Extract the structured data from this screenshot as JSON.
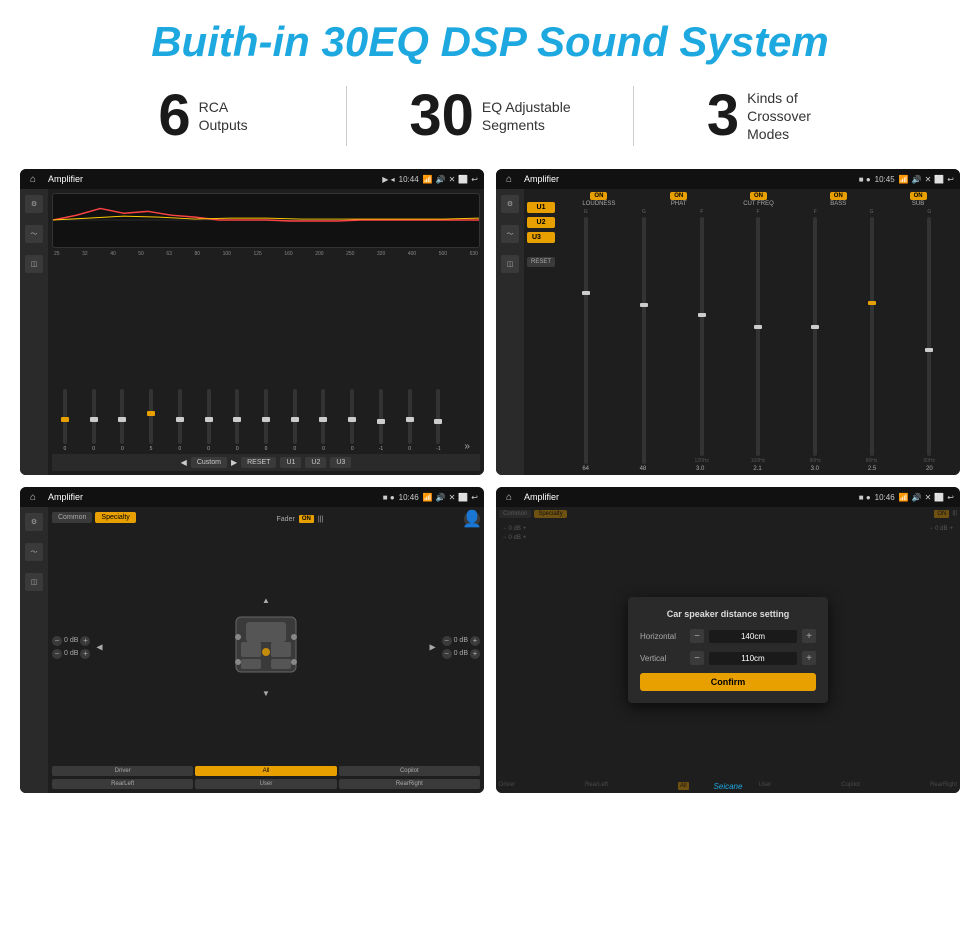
{
  "header": {
    "title": "Buith-in 30EQ DSP Sound System"
  },
  "stats": [
    {
      "number": "6",
      "text": "RCA\nOutputs"
    },
    {
      "number": "30",
      "text": "EQ Adjustable\nSegments"
    },
    {
      "number": "3",
      "text": "Kinds of\nCrossover Modes"
    }
  ],
  "screen1": {
    "title": "Amplifier",
    "time": "10:44",
    "freq_labels": [
      "25",
      "32",
      "40",
      "50",
      "63",
      "80",
      "100",
      "125",
      "160",
      "200",
      "250",
      "320",
      "400",
      "500",
      "630"
    ],
    "slider_values": [
      "0",
      "0",
      "0",
      "5",
      "0",
      "0",
      "0",
      "0",
      "0",
      "0",
      "0",
      "-1",
      "0",
      "-1"
    ],
    "bottom_buttons": [
      "Custom",
      "RESET",
      "U1",
      "U2",
      "U3"
    ]
  },
  "screen2": {
    "title": "Amplifier",
    "time": "10:45",
    "channels": [
      "LOUDNESS",
      "PHAT",
      "CUT FREQ",
      "BASS",
      "SUB"
    ],
    "u_buttons": [
      "U1",
      "U2",
      "U3"
    ],
    "reset_label": "RESET"
  },
  "screen3": {
    "title": "Amplifier",
    "time": "10:46",
    "tabs": [
      "Common",
      "Specialty"
    ],
    "fader_label": "Fader",
    "on_label": "ON",
    "positions": [
      "Driver",
      "RearLeft",
      "Copilot",
      "RearRight",
      "All",
      "User"
    ],
    "db_values": [
      "0 dB",
      "0 dB",
      "0 dB",
      "0 dB"
    ]
  },
  "screen4": {
    "title": "Amplifier",
    "time": "10:46",
    "dialog": {
      "title": "Car speaker distance setting",
      "horizontal_label": "Horizontal",
      "horizontal_value": "140cm",
      "vertical_label": "Vertical",
      "vertical_value": "110cm",
      "confirm_label": "Confirm",
      "right_db": "0 dB"
    },
    "tabs": [
      "Common",
      "Specialty"
    ],
    "positions": [
      "Driver",
      "RearLeft",
      "Copilot",
      "RearRight",
      "All",
      "User"
    ],
    "watermark": "Seicane"
  }
}
